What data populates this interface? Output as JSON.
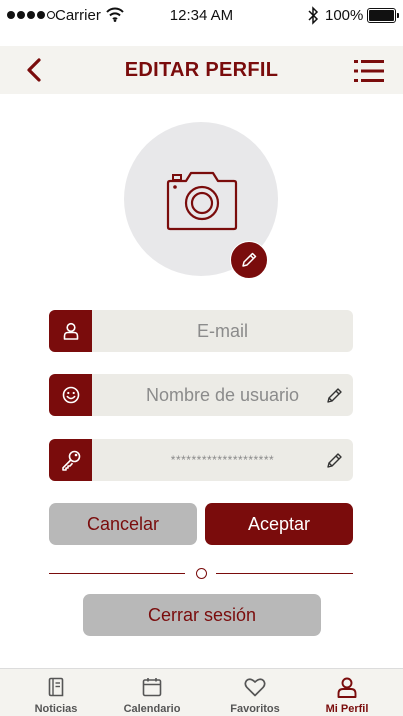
{
  "status_bar": {
    "carrier": "Carrier",
    "time": "12:34 AM",
    "battery": "100%"
  },
  "header": {
    "title": "EDITAR PERFIL",
    "back_icon": "chevron-left-icon",
    "menu_icon": "list-menu-icon"
  },
  "profile_photo": {
    "icon": "camera-icon",
    "edit_icon": "pencil-icon"
  },
  "form": {
    "email": {
      "icon": "user-icon",
      "placeholder": "E-mail"
    },
    "username": {
      "icon": "smiley-icon",
      "placeholder": "Nombre de usuario",
      "edit_icon": "pencil-icon"
    },
    "password": {
      "icon": "key-icon",
      "value": "********************",
      "edit_icon": "pencil-icon"
    }
  },
  "actions": {
    "cancel_label": "Cancelar",
    "accept_label": "Aceptar",
    "logout_label": "Cerrar sesión"
  },
  "tabs": [
    {
      "label": "Noticias",
      "icon": "news-icon",
      "active": false
    },
    {
      "label": "Calendario",
      "icon": "calendar-icon",
      "active": false
    },
    {
      "label": "Favoritos",
      "icon": "heart-icon",
      "active": false
    },
    {
      "label": "Mi Perfil",
      "icon": "user-icon",
      "active": true
    }
  ],
  "colors": {
    "accent": "#7a0c0c",
    "field_bg": "#ecebe6",
    "button_gray": "#b8b8b8",
    "bar_bg": "#f4f3ef"
  }
}
